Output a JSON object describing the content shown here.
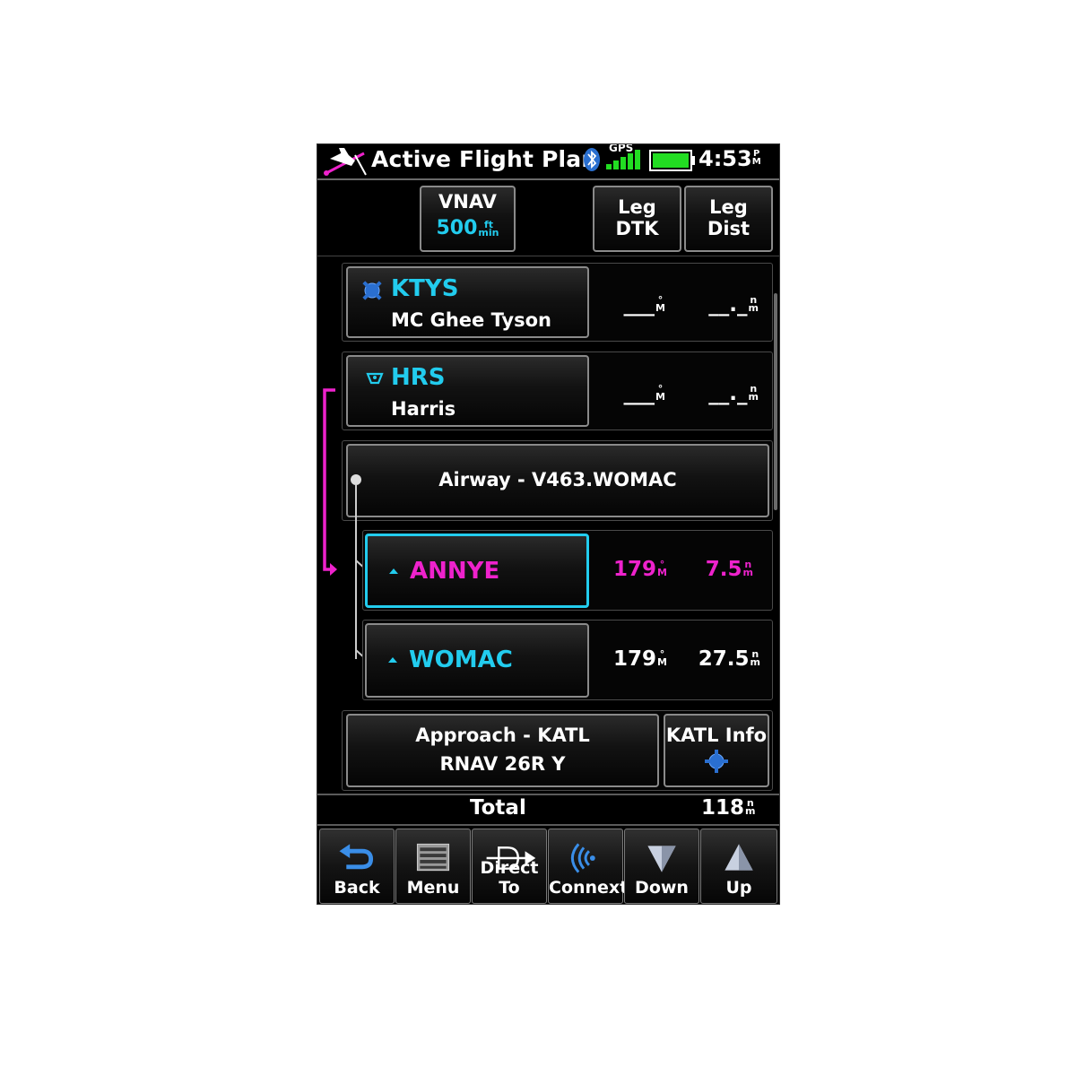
{
  "header": {
    "title": "Active Flight Plan",
    "gps_label": "GPS",
    "time": "4:53",
    "ampm_top": "P",
    "ampm_bottom": "M"
  },
  "columns": {
    "vnav_label": "VNAV",
    "vnav_value": "500",
    "vnav_unit_top": "ft",
    "vnav_unit_bottom": "min",
    "leg_dtk_line1": "Leg",
    "leg_dtk_line2": "DTK",
    "leg_dist_line1": "Leg",
    "leg_dist_line2": "Dist"
  },
  "waypoints": [
    {
      "id": "KTYS",
      "name": "MC Ghee Tyson",
      "dtk": "___",
      "dtk_unit_top": "°",
      "dtk_unit_bottom": "M",
      "dist": "__._",
      "dist_unit_top": "n",
      "dist_unit_bottom": "m"
    },
    {
      "id": "HRS",
      "name": "Harris",
      "dtk": "___",
      "dtk_unit_top": "°",
      "dtk_unit_bottom": "M",
      "dist": "__._",
      "dist_unit_top": "n",
      "dist_unit_bottom": "m"
    }
  ],
  "airway": {
    "label": "Airway - V463.WOMAC"
  },
  "airway_waypoints": [
    {
      "id": "ANNYE",
      "dtk": "179",
      "dtk_unit_top": "°",
      "dtk_unit_bottom": "M",
      "dist": "7.5",
      "dist_unit_top": "n",
      "dist_unit_bottom": "m",
      "active": true
    },
    {
      "id": "WOMAC",
      "dtk": "179",
      "dtk_unit_top": "°",
      "dtk_unit_bottom": "M",
      "dist": "27.5",
      "dist_unit_top": "n",
      "dist_unit_bottom": "m",
      "active": false
    }
  ],
  "approach": {
    "line1": "Approach - KATL",
    "line2": "RNAV 26R Y",
    "info_label": "KATL Info"
  },
  "total": {
    "label": "Total",
    "value": "118",
    "unit_top": "n",
    "unit_bottom": "m"
  },
  "softkeys": [
    {
      "label": "Back",
      "icon": "back-arrow-icon"
    },
    {
      "label": "Menu",
      "icon": "menu-list-icon"
    },
    {
      "label": "Direct To",
      "icon": "direct-to-icon"
    },
    {
      "label": "Connext",
      "icon": "connext-icon"
    },
    {
      "label": "Down",
      "icon": "down-arrow-icon"
    },
    {
      "label": "Up",
      "icon": "up-arrow-icon"
    }
  ],
  "colors": {
    "cyan": "#22ccee",
    "magenta": "#ee22cc",
    "battery_green": "#22dd22"
  }
}
